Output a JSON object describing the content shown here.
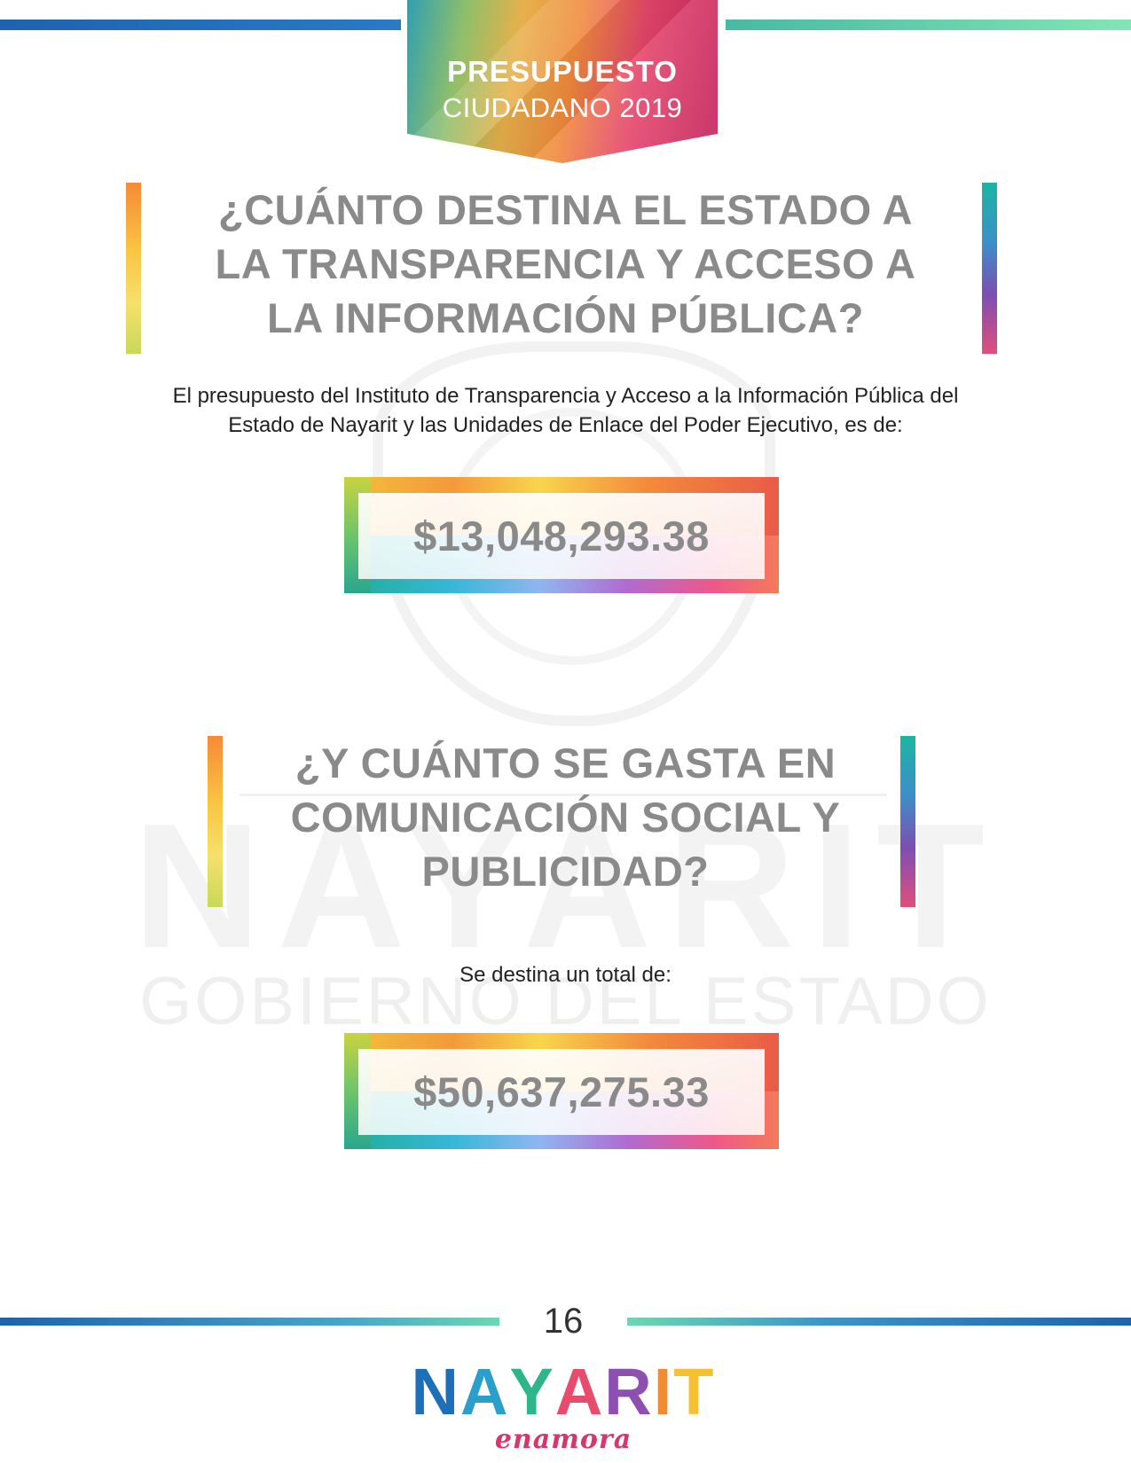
{
  "header": {
    "badge_title": "PRESUPUESTO",
    "badge_subtitle": "CIUDADANO 2019"
  },
  "section1": {
    "question_line1": "¿CUÁNTO DESTINA EL ESTADO A",
    "question_line2": "LA TRANSPARENCIA Y ACCESO A",
    "question_line3": "LA INFORMACIÓN PÚBLICA?",
    "paragraph_line1": "El presupuesto del Instituto de Transparencia y Acceso a la Información Pública del",
    "paragraph_line2": "Estado de Nayarit y las Unidades de Enlace del Poder Ejecutivo, es de:",
    "amount": "$13,048,293.38"
  },
  "section2": {
    "question_line1": "¿Y CUÁNTO SE GASTA EN",
    "question_line2": "COMUNICACIÓN SOCIAL Y",
    "question_line3": "PUBLICIDAD?",
    "paragraph": "Se destina un total de:",
    "amount": "$50,637,275.33"
  },
  "watermark": {
    "word": "NAYARIT",
    "subtitle": "GOBIERNO DEL ESTADO"
  },
  "footer": {
    "page_number": "16",
    "logo_letters": [
      {
        "char": "N",
        "color": "#1d6fb8"
      },
      {
        "char": "A",
        "color": "#2a9fc9"
      },
      {
        "char": "Y",
        "color": "#2fb58a"
      },
      {
        "char": "A",
        "color": "#e94b6c"
      },
      {
        "char": "R",
        "color": "#8d4fb0"
      },
      {
        "char": "I",
        "color": "#f28c34"
      },
      {
        "char": "T",
        "color": "#f5c130"
      }
    ],
    "logo_tagline": "enamora"
  },
  "colors": {
    "headline_gray": "#8a8a8a",
    "blue_bar": "#1f62ad",
    "green_bar": "#6dd7b0"
  }
}
